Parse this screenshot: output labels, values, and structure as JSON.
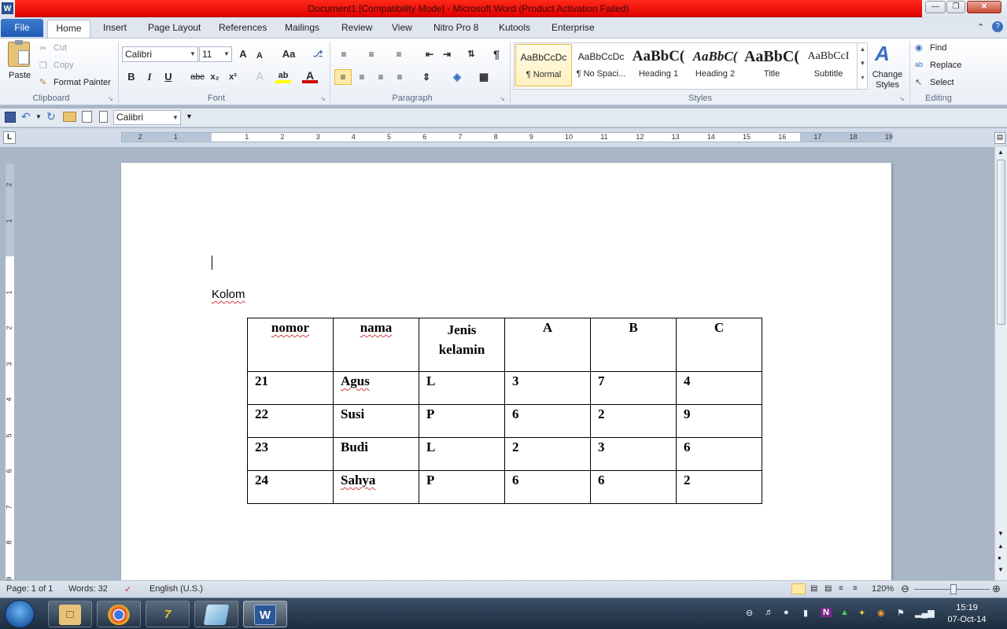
{
  "titlebar": {
    "title": "Document1 [Compatibility Mode]  -  Microsoft Word (Product Activation Failed)",
    "app_icon": "W"
  },
  "tabs": {
    "file": "File",
    "home": "Home",
    "insert": "Insert",
    "page_layout": "Page Layout",
    "references": "References",
    "mailings": "Mailings",
    "review": "Review",
    "view": "View",
    "nitro": "Nitro Pro 8",
    "kutools": "Kutools",
    "enterprise": "Enterprise"
  },
  "clipboard": {
    "paste": "Paste",
    "cut": "Cut",
    "copy": "Copy",
    "format_painter": "Format Painter",
    "label": "Clipboard"
  },
  "font": {
    "name": "Calibri",
    "size": "11",
    "label": "Font",
    "bold": "B",
    "italic": "I",
    "underline": "U",
    "strike": "abc",
    "subscript": "x₂",
    "superscript": "x²",
    "grow": "A",
    "shrink": "A",
    "change_case": "Aa"
  },
  "paragraph": {
    "label": "Paragraph",
    "pilcrow": "¶"
  },
  "styles": {
    "label": "Styles",
    "items": [
      {
        "sample": "AaBbCcDc",
        "name": "¶ Normal"
      },
      {
        "sample": "AaBbCcDc",
        "name": "¶ No Spaci..."
      },
      {
        "sample": "AaBbC(",
        "name": "Heading 1"
      },
      {
        "sample": "AaBbC(",
        "name": "Heading 2"
      },
      {
        "sample": "AaBbC(",
        "name": "Title"
      },
      {
        "sample": "AaBbCcI",
        "name": "Subtitle"
      }
    ],
    "change_styles": "Change Styles"
  },
  "editing": {
    "label": "Editing",
    "find": "Find",
    "replace": "Replace",
    "select": "Select"
  },
  "qat": {
    "font": "Calibri"
  },
  "ruler": {
    "labels": [
      "2",
      "1",
      "1",
      "2",
      "3",
      "4",
      "5",
      "6",
      "7",
      "8",
      "9",
      "10",
      "11",
      "12",
      "13",
      "14",
      "15",
      "16",
      "17",
      "18",
      "19"
    ]
  },
  "vruler": {
    "labels": [
      "2",
      "1",
      "1",
      "2",
      "3",
      "4",
      "5",
      "6",
      "7",
      "8",
      "9"
    ]
  },
  "document": {
    "heading": "Kolom",
    "table": {
      "headers": [
        "nomor",
        "nama",
        "Jenis kelamin",
        "A",
        "B",
        "C"
      ],
      "rows": [
        [
          "21",
          "Agus",
          "L",
          "3",
          "7",
          "4"
        ],
        [
          "22",
          "Susi",
          "P",
          "6",
          "2",
          "9"
        ],
        [
          "23",
          "Budi",
          "L",
          "2",
          "3",
          "6"
        ],
        [
          "24",
          "Sahya",
          "P",
          "6",
          "6",
          "2"
        ]
      ]
    }
  },
  "status": {
    "page": "Page: 1 of 1",
    "words": "Words: 32",
    "language": "English (U.S.)",
    "zoom": "120%"
  },
  "taskbar": {
    "time": "15:19",
    "date": "07-Oct-14"
  }
}
